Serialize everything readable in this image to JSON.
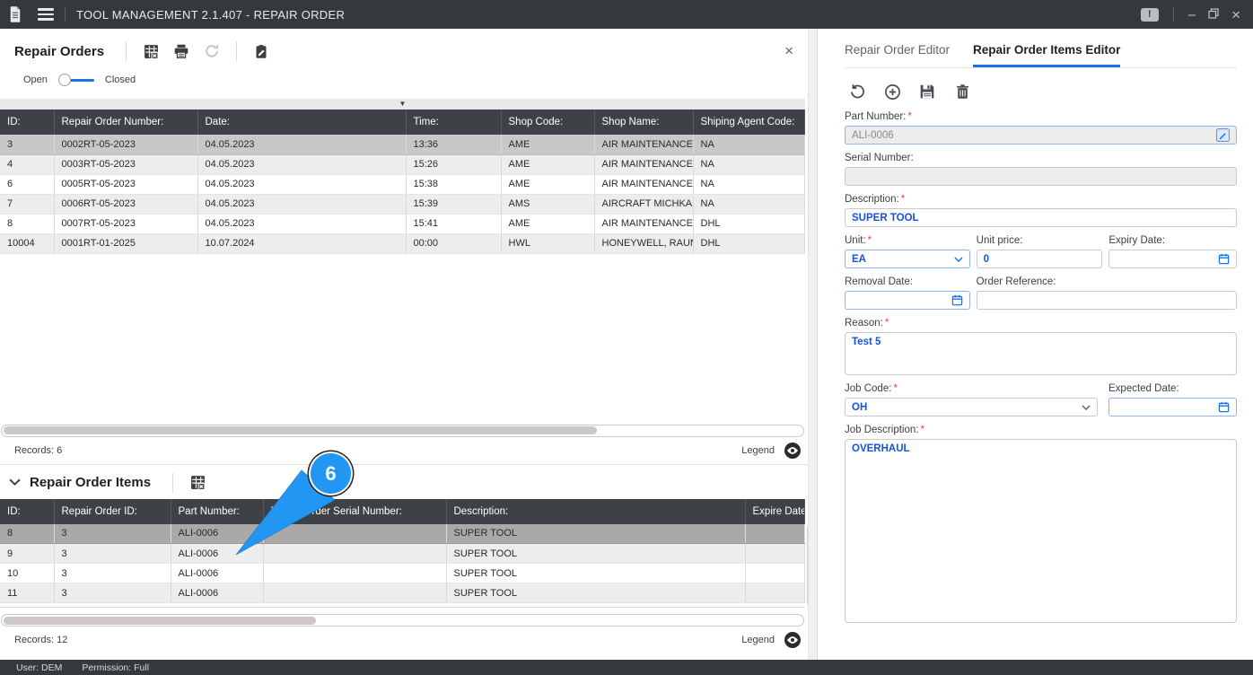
{
  "window": {
    "title": "TOOL MANAGEMENT 2.1.407 - REPAIR ORDER"
  },
  "icons": {
    "alert_glyph": "!",
    "minimize_glyph": "–",
    "close_glyph": "×",
    "collapse_arrow_glyph": "▼"
  },
  "statusbar": {
    "user": "User: DEM",
    "permission": "Permission: Full"
  },
  "colors": {
    "accent_blue": "#1a73e8",
    "annotation_blue": "#2196f3",
    "titlebar_dark": "#35393d",
    "grid_header_dark": "#3e4247",
    "selected_row_gray": "#c8c8c8",
    "field_value_blue": "#1753d3",
    "required_red": "#e8452c"
  },
  "left": {
    "title": "Repair Orders",
    "toggle": {
      "left_label": "Open",
      "right_label": "Closed",
      "state": "Open"
    },
    "records_label": "Records: 6",
    "legend_label": "Legend",
    "table": {
      "headers": [
        "ID:",
        "Repair Order Number:",
        "Date:",
        "Time:",
        "Shop Code:",
        "Shop Name:",
        "Shiping Agent Code:"
      ],
      "rows": [
        [
          "3",
          "0002RT-05-2023",
          "04.05.2023",
          "13:36",
          "AME",
          "AIR MAINTENANCE E...",
          "NA"
        ],
        [
          "4",
          "0003RT-05-2023",
          "04.05.2023",
          "15:26",
          "AME",
          "AIR MAINTENANCE E...",
          "NA"
        ],
        [
          "6",
          "0005RT-05-2023",
          "04.05.2023",
          "15:38",
          "AME",
          "AIR MAINTENANCE E...",
          "NA"
        ],
        [
          "7",
          "0006RT-05-2023",
          "04.05.2023",
          "15:39",
          "AMS",
          "AIRCRAFT MICHKAS...",
          "NA"
        ],
        [
          "8",
          "0007RT-05-2023",
          "04.05.2023",
          "15:41",
          "AME",
          "AIR MAINTENANCE E...",
          "DHL"
        ],
        [
          "10004",
          "0001RT-01-2025",
          "10.07.2024",
          "00:00",
          "HWL",
          "HONEYWELL, RAUNH...",
          "DHL"
        ]
      ],
      "selected_index": 0
    },
    "items_section": {
      "title": "Repair Order Items",
      "records_label": "Records: 12",
      "legend_label": "Legend",
      "table": {
        "headers": [
          "ID:",
          "Repair Order ID:",
          "Part Number:",
          "Repair Order Serial Number:",
          "Description:",
          "Expire Date:"
        ],
        "rows": [
          [
            "8",
            "3",
            "ALI-0006",
            "",
            "SUPER TOOL",
            ""
          ],
          [
            "9",
            "3",
            "ALI-0006",
            "",
            "SUPER TOOL",
            ""
          ],
          [
            "10",
            "3",
            "ALI-0006",
            "",
            "SUPER TOOL",
            ""
          ],
          [
            "11",
            "3",
            "ALI-0006",
            "",
            "SUPER TOOL",
            ""
          ]
        ],
        "selected_index": 0
      }
    }
  },
  "right": {
    "tabs": [
      {
        "label": "Repair Order Editor",
        "active": false
      },
      {
        "label": "Repair Order Items Editor",
        "active": true
      }
    ],
    "form": {
      "required_marker": "*",
      "part_number": {
        "label": "Part Number:",
        "required": true,
        "value": "ALI-0006"
      },
      "serial_number": {
        "label": "Serial Number:",
        "required": false,
        "value": ""
      },
      "description": {
        "label": "Description:",
        "required": true,
        "value": "SUPER TOOL"
      },
      "unit": {
        "label": "Unit:",
        "required": true,
        "value": "EA"
      },
      "unit_price": {
        "label": "Unit price:",
        "required": false,
        "value": "0"
      },
      "expiry_date": {
        "label": "Expiry Date:",
        "required": false,
        "value": ""
      },
      "removal_date": {
        "label": "Removal Date:",
        "required": false,
        "value": ""
      },
      "order_reference": {
        "label": "Order Reference:",
        "required": false,
        "value": ""
      },
      "reason": {
        "label": "Reason:",
        "required": true,
        "value": "Test 5"
      },
      "job_code": {
        "label": "Job Code:",
        "required": true,
        "value": "OH"
      },
      "expected_date": {
        "label": "Expected Date:",
        "required": false,
        "value": ""
      },
      "job_description": {
        "label": "Job Description:",
        "required": true,
        "value": "OVERHAUL"
      }
    }
  },
  "annotation": {
    "label": "6"
  }
}
